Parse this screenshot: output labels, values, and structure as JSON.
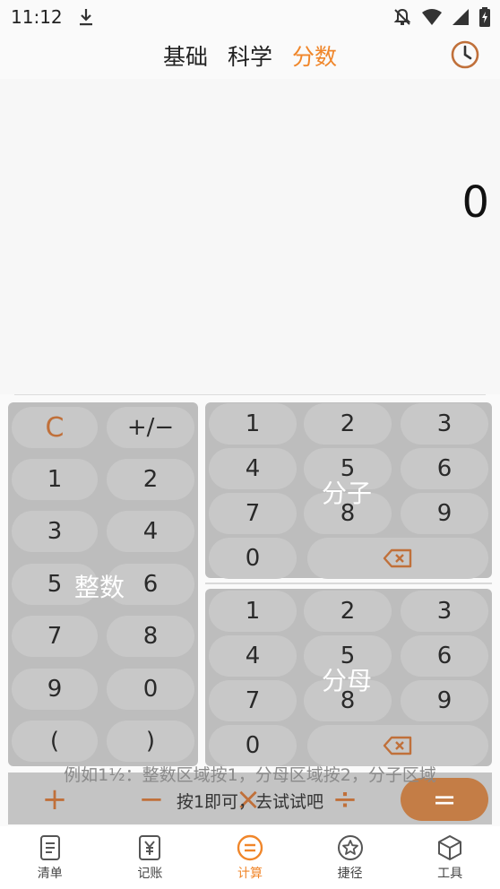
{
  "status": {
    "time": "11:12"
  },
  "tabs": [
    {
      "label": "基础"
    },
    {
      "label": "科学"
    },
    {
      "label": "分数"
    }
  ],
  "active_tab": "分数",
  "display": {
    "value": "0"
  },
  "integer_panel": {
    "label": "整数",
    "keys": [
      "C",
      "+/−",
      "1",
      "2",
      "3",
      "4",
      "5",
      "6",
      "7",
      "8",
      "9",
      "0",
      "(",
      ")"
    ]
  },
  "numerator_panel": {
    "label": "分子",
    "keys": [
      "1",
      "2",
      "3",
      "4",
      "5",
      "6",
      "7",
      "8",
      "9",
      "0"
    ]
  },
  "denominator_panel": {
    "label": "分母",
    "keys": [
      "1",
      "2",
      "3",
      "4",
      "5",
      "6",
      "7",
      "8",
      "9",
      "0"
    ]
  },
  "operators": {
    "plus": "+",
    "minus": "−",
    "times": "×",
    "divide": "÷",
    "equals": "="
  },
  "hint": {
    "line1": "例如1½：整数区域按1，分母区域按2，分子区域",
    "line2": "按1即可，去试试吧"
  },
  "bottom_nav": [
    {
      "label": "清单"
    },
    {
      "label": "记账"
    },
    {
      "label": "计算"
    },
    {
      "label": "捷径"
    },
    {
      "label": "工具"
    }
  ],
  "colors": {
    "accent": "#f0862a",
    "equals_button": "#c47d46",
    "panel": "#bdbdbd"
  }
}
